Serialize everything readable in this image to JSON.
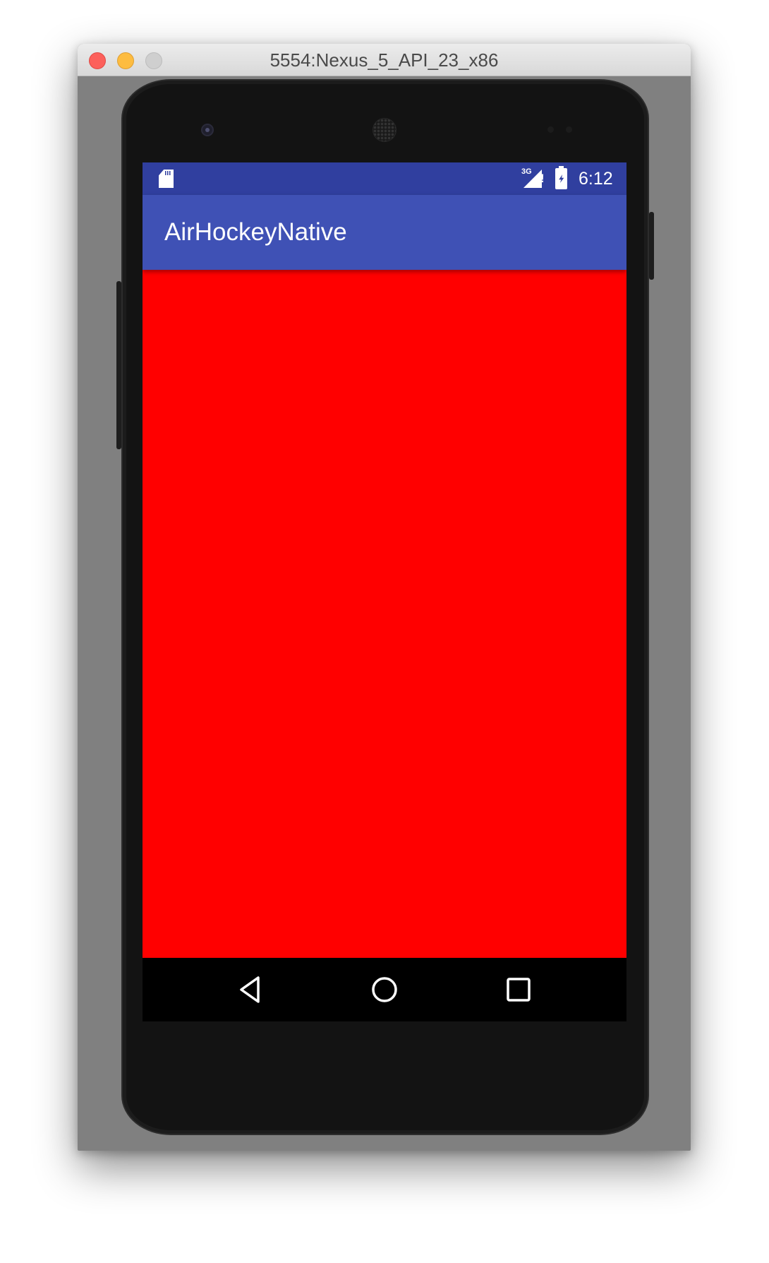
{
  "window": {
    "title": "5554:Nexus_5_API_23_x86"
  },
  "status_bar": {
    "network_type": "3G",
    "time": "6:12",
    "icons": [
      "sd-card-icon",
      "signal-icon",
      "battery-charging-icon"
    ]
  },
  "app_bar": {
    "title": "AirHockeyNative"
  },
  "content": {
    "background_color": "#ff0000"
  },
  "nav_bar": {
    "buttons": [
      "back-icon",
      "home-icon",
      "recent-apps-icon"
    ]
  },
  "colors": {
    "status_bar": "#303f9f",
    "app_bar": "#3f51b5",
    "content": "#ff0000"
  }
}
